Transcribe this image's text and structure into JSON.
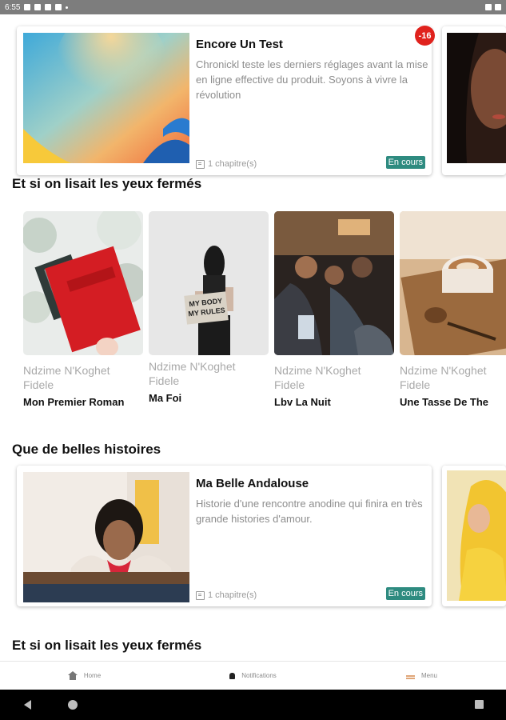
{
  "status_bar": {
    "time": "6:55"
  },
  "featured": [
    {
      "title": "Encore Un Test",
      "description": "Chronickl teste les derniers réglages avant la mise en ligne effective du produit. Soyons à vivre la révolution",
      "chapters": "1 chapitre(s)",
      "status": "En cours",
      "discount": "-16"
    },
    {
      "title": "Ma Belle Andalouse",
      "description": "Historie d'une rencontre anodine qui finira en très grande histories d'amour.",
      "chapters": "1 chapitre(s)",
      "status": "En cours"
    }
  ],
  "sections": {
    "eyes_closed": "Et si on lisait les yeux fermés",
    "beautiful_stories": "Que de belles histoires",
    "eyes_closed_2": "Et si on lisait les yeux fermés"
  },
  "books": [
    {
      "author": "Ndzime N'Koghet Fidele",
      "title": "Mon Premier Roman"
    },
    {
      "author": "Ndzime N'Koghet Fidele",
      "title": "Ma Foi",
      "cover_text": "MY BODY MY RULES"
    },
    {
      "author": "Ndzime N'Koghet Fidele",
      "title": "Lbv La Nuit"
    },
    {
      "author": "Ndzime N'Koghet Fidele",
      "title": "Une Tasse De The"
    }
  ],
  "bottom_nav": {
    "home": "Home",
    "notifications": "Notifications",
    "menu": "Menu"
  },
  "colors": {
    "accent": "#2e8b80",
    "discount": "#e0221d"
  }
}
